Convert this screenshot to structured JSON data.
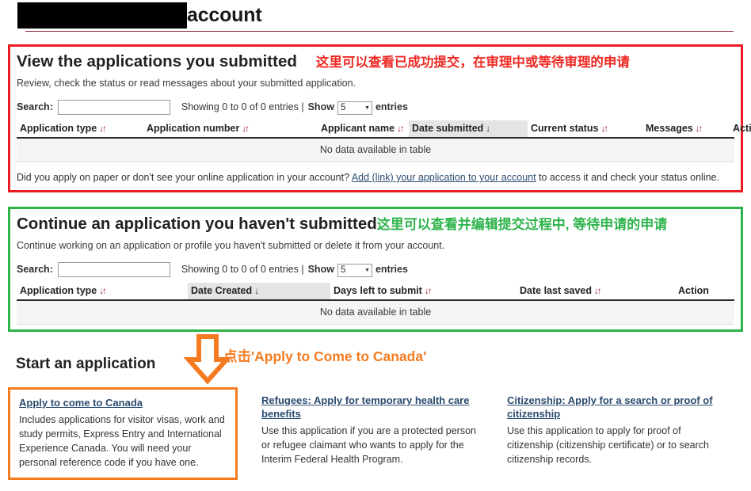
{
  "header": {
    "redacted": true,
    "title": "account"
  },
  "submitted_section": {
    "title": "View the applications you submitted",
    "annotation": "这里可以查看已成功提交，在审理中或等待审理的申请",
    "annotation_color": "#ee2a24",
    "border_color": "#ed1c24",
    "subtitle": "Review, check the status or read messages about your submitted application.",
    "controls": {
      "search_label": "Search:",
      "search_value": "",
      "search_placeholder": "",
      "showing_text": "Showing 0 to 0 of 0 entries |",
      "show_label": "Show",
      "entries_value": "5",
      "entries_label": "entries",
      "caret_icon": "chevron-down-icon"
    },
    "table": {
      "columns": [
        {
          "label": "Application type",
          "sort": "both",
          "sorted": false
        },
        {
          "label": "Application number",
          "sort": "both",
          "sorted": false
        },
        {
          "label": "Applicant name",
          "sort": "both",
          "sorted": false
        },
        {
          "label": "Date submitted",
          "sort": "desc",
          "sorted": true
        },
        {
          "label": "Current status",
          "sort": "both",
          "sorted": false
        },
        {
          "label": "Messages",
          "sort": "both",
          "sorted": false
        },
        {
          "label": "Action",
          "sort": "none",
          "sorted": false
        }
      ],
      "empty_message": "No data available in table",
      "rows": []
    },
    "footnote_before": "Did you apply on paper or don't see your online application in your account?",
    "footnote_link": "Add (link) your application to your account",
    "footnote_after": "to access it and check your status online."
  },
  "continue_section": {
    "title": "Continue an application you haven't submitted",
    "annotation": "这里可以查看并编辑提交过程中, 等待申请的申请",
    "annotation_color": "#2cb34a",
    "border_color": "#2cb34a",
    "subtitle": "Continue working on an application or profile you haven't submitted or delete it from your account.",
    "controls": {
      "search_label": "Search:",
      "search_value": "",
      "search_placeholder": "",
      "showing_text": "Showing 0 to 0 of 0 entries |",
      "show_label": "Show",
      "entries_value": "5",
      "entries_label": "entries",
      "caret_icon": "chevron-down-icon"
    },
    "table": {
      "columns": [
        {
          "label": "Application type",
          "sort": "both",
          "sorted": false
        },
        {
          "label": "Date Created",
          "sort": "desc",
          "sorted": true
        },
        {
          "label": "Days left to submit",
          "sort": "both",
          "sorted": false
        },
        {
          "label": "Date last saved",
          "sort": "both",
          "sorted": false
        },
        {
          "label": "Action",
          "sort": "none",
          "sorted": false
        }
      ],
      "empty_message": "No data available in table",
      "rows": []
    }
  },
  "start_section": {
    "title": "Start an application",
    "annotation": "点击'Apply to Come to Canada'",
    "annotation_color": "#f47b20",
    "arrow_icon": "arrow-down-icon",
    "cards": [
      {
        "link": "Apply to come to Canada",
        "desc": "Includes applications for visitor visas, work and study permits, Express Entry and International Experience Canada. You will need your personal reference code if you have one.",
        "highlighted": true
      },
      {
        "link": "Refugees: Apply for temporary health care benefits",
        "desc": "Use this application if you are a protected person or refugee claimant who wants to apply for the Interim Federal Health Program.",
        "highlighted": false
      },
      {
        "link": "Citizenship: Apply for a search or proof of citizenship ",
        "desc": "Use this application to apply for proof of citizenship (citizenship certificate) or to search citizenship records.",
        "highlighted": false
      }
    ]
  },
  "icons": {
    "sort_both": "↓↑",
    "sort_desc": "↓"
  }
}
